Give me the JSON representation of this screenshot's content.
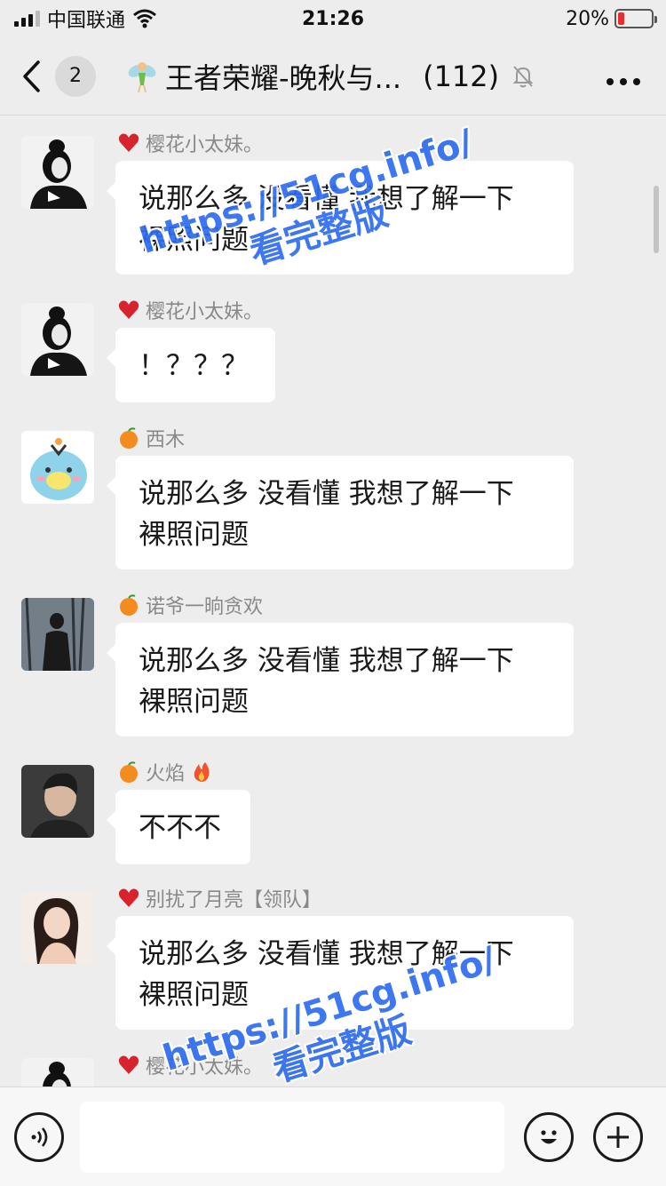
{
  "status": {
    "carrier": "中国联通",
    "time": "21:26",
    "battery": "20%",
    "battery_level": 0.2
  },
  "header": {
    "unread_count": "2",
    "title": "王者荣耀-晚秋与...",
    "member_count": "(112)"
  },
  "messages": [
    {
      "sender": "樱花小太妹。",
      "sender_emoji": "heart",
      "line1": "说那么多 没看懂 我想了解一下",
      "line2": "裸照问题"
    },
    {
      "sender": "樱花小太妹。",
      "sender_emoji": "heart",
      "line1": "！？？？",
      "line2": ""
    },
    {
      "sender": "西木",
      "sender_emoji": "orange",
      "line1": "说那么多 没看懂 我想了解一下",
      "line2": "裸照问题"
    },
    {
      "sender": "诺爷一晌贪欢",
      "sender_emoji": "orange",
      "line1": "说那么多 没看懂 我想了解一下",
      "line2": "裸照问题"
    },
    {
      "sender": "火焰",
      "sender_emoji": "orange",
      "line1": "不不不",
      "line2": ""
    },
    {
      "sender": "别扰了月亮【领队】",
      "sender_emoji": "heart",
      "line1": "说那么多 没看懂 我想了解一下",
      "line2": "裸照问题"
    },
    {
      "sender": "樱花小太妹。",
      "sender_emoji": "heart",
      "line1": "",
      "line2": ""
    }
  ],
  "watermarks": [
    {
      "line1": "https://51cg.info/",
      "line2": "看完整版"
    },
    {
      "line1": "https://51cg.info/",
      "line2": "看完整版"
    }
  ],
  "input": {
    "value": "",
    "placeholder": ""
  },
  "colors": {
    "background": "#ededed",
    "bubble": "#ffffff",
    "watermark": "#2d6cf0",
    "battery_low": "#e3302f"
  }
}
